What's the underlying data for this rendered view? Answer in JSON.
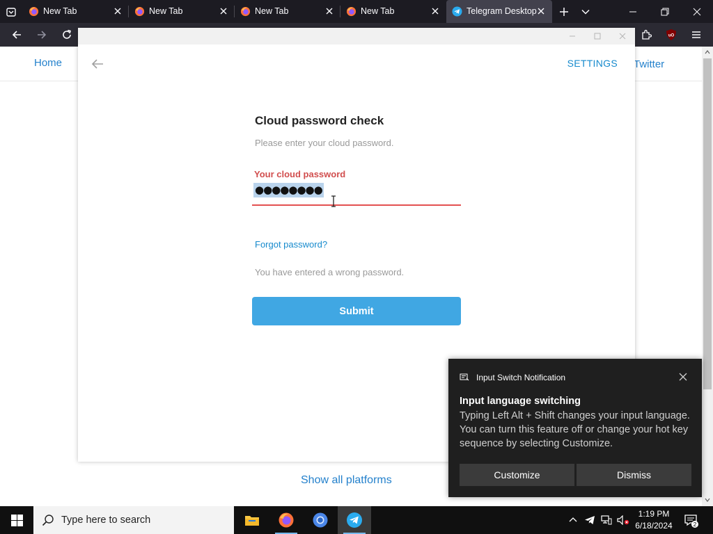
{
  "browser": {
    "tabs": [
      {
        "title": "New Tab",
        "icon": "firefox-icon",
        "active": false
      },
      {
        "title": "New Tab",
        "icon": "firefox-icon",
        "active": false
      },
      {
        "title": "New Tab",
        "icon": "firefox-icon",
        "active": false
      },
      {
        "title": "New Tab",
        "icon": "firefox-icon",
        "active": false
      },
      {
        "title": "Telegram Desktop",
        "icon": "telegram-icon",
        "active": true
      }
    ],
    "extension_badge": "uO"
  },
  "webpage": {
    "nav_home": "Home",
    "nav_twitter": "Twitter",
    "show_all": "Show all platforms"
  },
  "telegram": {
    "settings": "SETTINGS",
    "heading": "Cloud password check",
    "description": "Please enter your cloud password.",
    "password_label": "Your cloud password",
    "password_value": "●●●●●●●●",
    "forgot": "Forgot password?",
    "error": "You have entered a wrong password.",
    "submit": "Submit"
  },
  "toast": {
    "app": "Input Switch Notification",
    "title": "Input language switching",
    "body": "Typing Left Alt + Shift changes your input language. You can turn this feature off or change your hot key sequence by selecting Customize.",
    "customize": "Customize",
    "dismiss": "Dismiss"
  },
  "taskbar": {
    "search_placeholder": "Type here to search",
    "time": "1:19 PM",
    "date": "6/18/2024",
    "notification_count": "2"
  },
  "colors": {
    "telegram_blue": "#40a7e3",
    "error_red": "#d14e4e",
    "link_blue": "#2481cc"
  }
}
